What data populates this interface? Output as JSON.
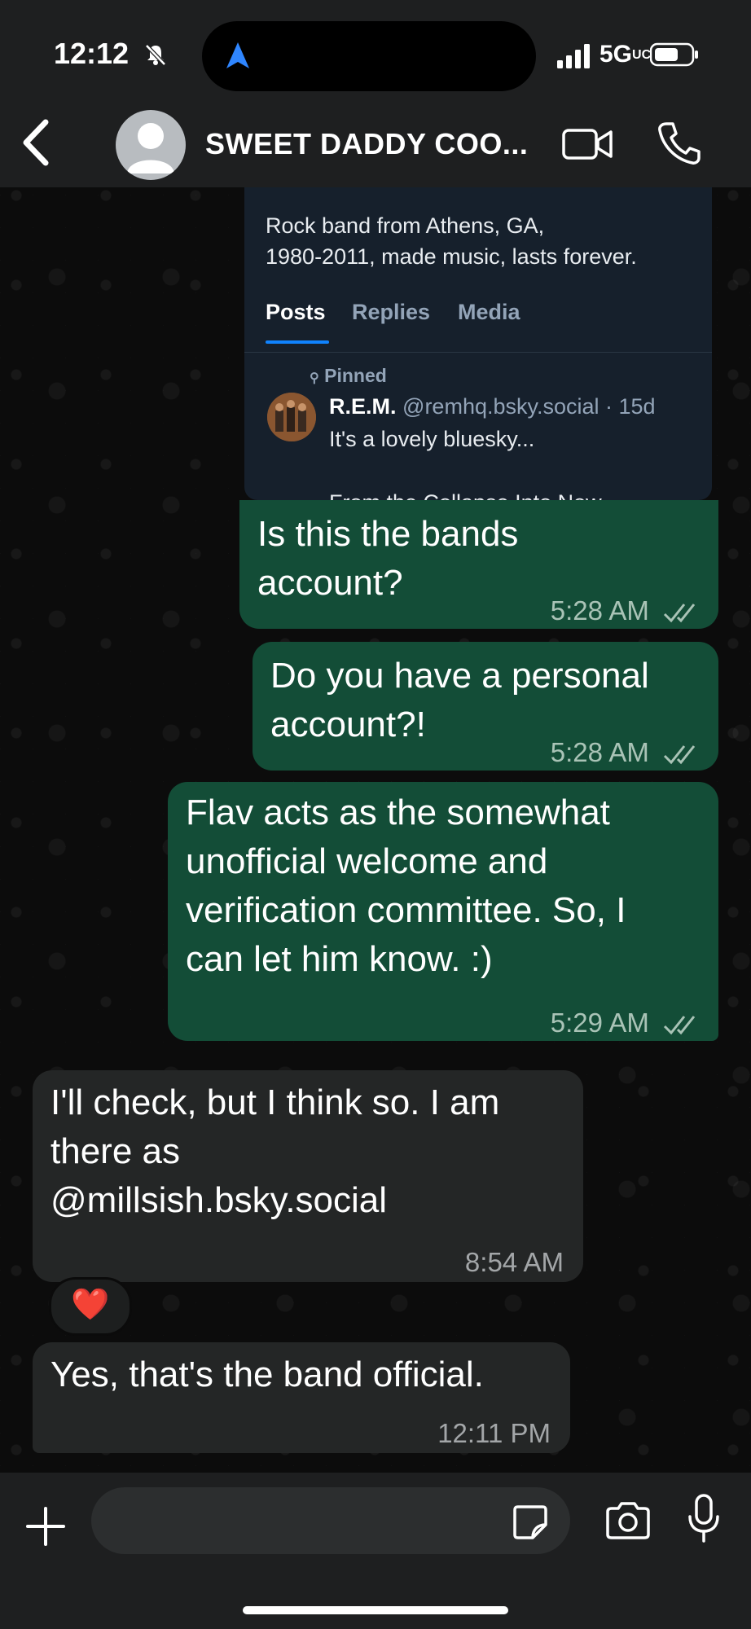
{
  "status_bar": {
    "time": "12:12",
    "network": "5G",
    "network_suffix": "UC"
  },
  "header": {
    "contact_name": "SWEET DADDY COO..."
  },
  "link_preview": {
    "bio_line1": "Rock band from Athens, GA,",
    "bio_line2": "1980-2011, made music, lasts forever.",
    "tabs": [
      "Posts",
      "Replies",
      "Media"
    ],
    "active_tab": "Posts",
    "pinned_label": "Pinned",
    "post_author_name": "R.E.M.",
    "post_author_handle": "@remhq.bsky.social · 15d",
    "post_text": "It's a lovely bluesky...",
    "post_text_continued": "From the Collapse Into Now"
  },
  "messages": [
    {
      "direction": "out",
      "lines": [
        "Is this the bands",
        "account?"
      ],
      "time": "5:28 AM",
      "read": true
    },
    {
      "direction": "out",
      "lines": [
        "Do you have a personal",
        "account?!"
      ],
      "time": "5:28 AM",
      "read": true
    },
    {
      "direction": "out",
      "lines": [
        "Flav acts as the somewhat",
        "unofficial welcome and",
        "verification committee. So, I",
        "can let him know. :)"
      ],
      "time": "5:29 AM",
      "read": true
    },
    {
      "direction": "in",
      "lines": [
        "I'll check, but I think so. I am",
        "there as",
        "@millsish.bsky.social"
      ],
      "time": "8:54 AM"
    },
    {
      "direction": "in",
      "lines": [
        "Yes, that's the band official."
      ],
      "time": "12:11 PM"
    }
  ],
  "reaction": {
    "emoji": "❤️"
  },
  "colors": {
    "outgoing_bubble": "#134d37",
    "incoming_bubble": "#242626",
    "accent_blue": "#1083fe"
  },
  "icons": [
    "bell-slash-icon",
    "location-arrow-icon",
    "signal-icon",
    "battery-icon",
    "back-chevron-icon",
    "video-call-icon",
    "phone-call-icon",
    "plus-icon",
    "sticker-icon",
    "camera-icon",
    "microphone-icon",
    "double-check-icon"
  ]
}
